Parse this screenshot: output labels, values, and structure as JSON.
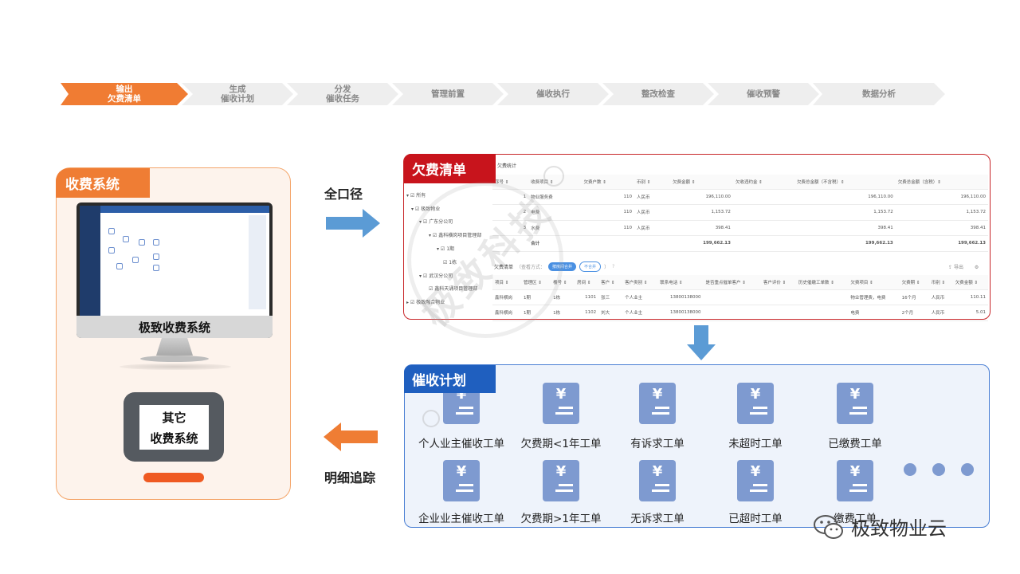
{
  "process_steps": [
    {
      "line1": "输出",
      "line2": "欠费清单",
      "active": true
    },
    {
      "line1": "生成",
      "line2": "催收计划",
      "active": false
    },
    {
      "line1": "分发",
      "line2": "催收任务",
      "active": false
    },
    {
      "line1": "管理前置",
      "line2": "",
      "active": false
    },
    {
      "line1": "催收执行",
      "line2": "",
      "active": false
    },
    {
      "line1": "整改检查",
      "line2": "",
      "active": false
    },
    {
      "line1": "催收预警",
      "line2": "",
      "active": false
    },
    {
      "line1": "数据分析",
      "line2": "",
      "active": false
    }
  ],
  "left": {
    "tag": "收费系统",
    "monitor_label": "极致收费系统",
    "device_line1": "其它",
    "device_line2": "收费系统"
  },
  "middle": {
    "top_label": "全口径",
    "bottom_label": "明细追踪"
  },
  "arrears": {
    "tag": "欠费清单",
    "stat_title": "欠费统计",
    "tree": [
      "▾ ☑ 所有",
      "▾ ☑ 极致物业",
      "▾ ☑ 广东分公司",
      "▾ ☑ 鑫科横岗项目管理部",
      "▾ ☑ 1期",
      "☑ 1栋",
      "▾ ☑ 武汉分公司",
      "☑ 鑫科天诵项目管理部",
      "▸ ☑ 极致融合物业"
    ],
    "stat_headers": [
      "序号 ⇕",
      "收费项目 ⇕",
      "欠费户数 ⇕",
      "币别 ⇕",
      "欠费金额 ⇕",
      "欠收违约金 ⇕",
      "欠费总金额（不含税）⇕",
      "欠费总金额（含税）⇕"
    ],
    "stat_rows": [
      [
        "1",
        "物业服务费",
        "110",
        "人民币",
        "196,110.00",
        "",
        "196,110.00",
        "196,110.00"
      ],
      [
        "2",
        "电费",
        "110",
        "人民币",
        "1,153.72",
        "",
        "1,153.72",
        "1,153.72"
      ],
      [
        "3",
        "水费",
        "110",
        "人民币",
        "398.41",
        "",
        "398.41",
        "398.41"
      ],
      [
        "",
        "合计",
        "",
        "",
        "199,662.13",
        "",
        "199,662.13",
        "199,662.13"
      ]
    ],
    "list_title": "欠费清单",
    "list_mode": "（查看方式：",
    "list_opt_on": "按房间合并",
    "list_opt_off": "不合并",
    "list_close": "）",
    "export": "导出",
    "list_headers": [
      "项目 ⇕",
      "管理区 ⇕",
      "楼号 ⇕",
      "房间 ⇕",
      "客户 ⇕",
      "客户类别 ⇕",
      "联系电话 ⇕",
      "是否重点催单客户 ⇕",
      "客户评价 ⇕",
      "历史催缴工单数 ⇕",
      "欠费项目 ⇕",
      "欠费期 ⇕",
      "币别 ⇕",
      "欠费金额 ⇕"
    ],
    "list_rows": [
      [
        "鑫科横岗",
        "1期",
        "1栋",
        "1101",
        "张三",
        "个人业主",
        "13800138000",
        "",
        "",
        "",
        "物业管理费，电费",
        "16个月",
        "人民币",
        "110.11"
      ],
      [
        "鑫科横岗",
        "1期",
        "1栋",
        "1102",
        "刘大",
        "个人业主",
        "13800138000",
        "",
        "",
        "",
        "电费",
        "2个月",
        "人民币",
        "5.01"
      ]
    ]
  },
  "plan": {
    "tag": "催收计划",
    "icon_glyph": "¥",
    "items_row1": [
      "个人业主催收工单",
      "欠费期<1年工单",
      "有诉求工单",
      "未超时工单",
      "已缴费工单"
    ],
    "items_row2": [
      "企业业主催收工单",
      "欠费期>1年工单",
      "无诉求工单",
      "已超时工单",
      "缴费工单"
    ]
  },
  "watermark": "极致科技",
  "brand": "极致物业云",
  "colors": {
    "orange": "#ef7d34",
    "red": "#c8141c",
    "blue": "#1f5fbf",
    "icon": "#7e9ad0",
    "arrow": "#5b9bd5"
  }
}
